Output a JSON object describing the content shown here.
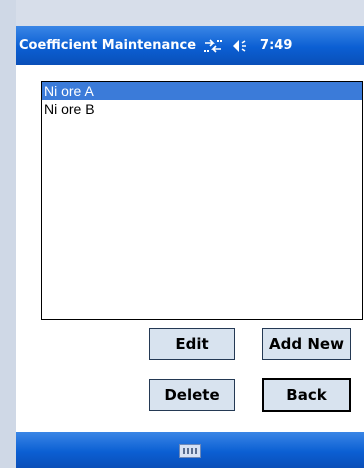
{
  "titlebar": {
    "title": "Coefficient Maintenance",
    "connectivity_icon": "connectivity-icon",
    "volume_icon": "volume-icon",
    "time": "7:49"
  },
  "list": {
    "items": [
      "Ni ore A",
      "Ni ore B"
    ],
    "selected_index": 0
  },
  "buttons": {
    "edit": "Edit",
    "add_new": "Add New",
    "delete": "Delete",
    "back": "Back"
  },
  "menubar": {
    "keyboard_icon": "keyboard-icon"
  },
  "colors": {
    "titlebar": "#0b5fd3",
    "selection": "#3b7bd9",
    "button_face": "#d8e3ef"
  }
}
